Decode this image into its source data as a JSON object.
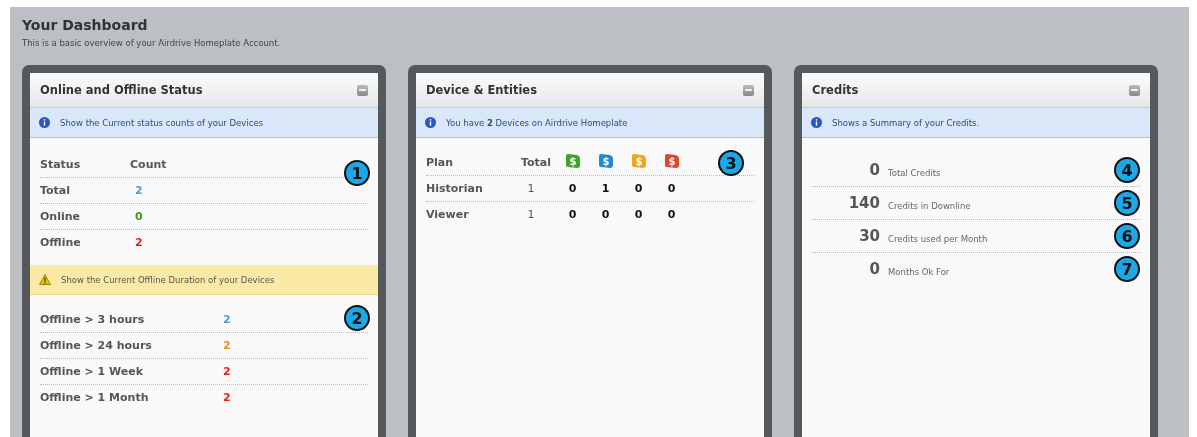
{
  "page": {
    "title": "Your Dashboard",
    "subtitle": "This is a basic overview of your Airdrive Homeplate Account."
  },
  "status_panel": {
    "title": "Online and Offline Status",
    "info": "Show the Current status counts of your Devices",
    "headers": [
      "Status",
      "Count"
    ],
    "marker": "1",
    "rows": [
      {
        "label": "Total",
        "value": "2",
        "color": "#4a9be0"
      },
      {
        "label": "Online",
        "value": "0",
        "color": "#3a9a1a"
      },
      {
        "label": "Offline",
        "value": "2",
        "color": "#e02020"
      }
    ],
    "warning": "Show the Current Offline Duration of your Devices",
    "duration_marker": "2",
    "durations": [
      {
        "label": "Offline > 3 hours",
        "value": "2",
        "color": "#4a9be0"
      },
      {
        "label": "Offline > 24 hours",
        "value": "2",
        "color": "#f08a1a"
      },
      {
        "label": "Offline > 1 Week",
        "value": "2",
        "color": "#e02020"
      },
      {
        "label": "Offline > 1 Month",
        "value": "2",
        "color": "#e02020"
      }
    ]
  },
  "devices_panel": {
    "title": "Device & Entities",
    "info": "You have **2** Devices on Airdrive Homeplate",
    "marker": "3",
    "headers": [
      "Plan",
      "Total"
    ],
    "plan_icons": [
      {
        "color": "#3fa52a",
        "symbol": "$"
      },
      {
        "color": "#1f8ad8",
        "symbol": "$"
      },
      {
        "color": "#f0a81a",
        "symbol": "$"
      },
      {
        "color": "#e0462a",
        "symbol": "$"
      }
    ],
    "rows": [
      {
        "plan": "Historian",
        "total": "1",
        "counts": [
          "0",
          "1",
          "0",
          "0"
        ]
      },
      {
        "plan": "Viewer",
        "total": "1",
        "counts": [
          "0",
          "0",
          "0",
          "0"
        ]
      }
    ]
  },
  "credits_panel": {
    "title": "Credits",
    "info": "Shows a Summary of your Credits.",
    "rows": [
      {
        "value": "0",
        "label": "Total Credits",
        "marker": "4"
      },
      {
        "value": "140",
        "label": "Credits in Downline",
        "marker": "5"
      },
      {
        "value": "30",
        "label": "Credits used per Month",
        "marker": "6"
      },
      {
        "value": "0",
        "label": "Months Ok For",
        "marker": "7"
      }
    ]
  }
}
